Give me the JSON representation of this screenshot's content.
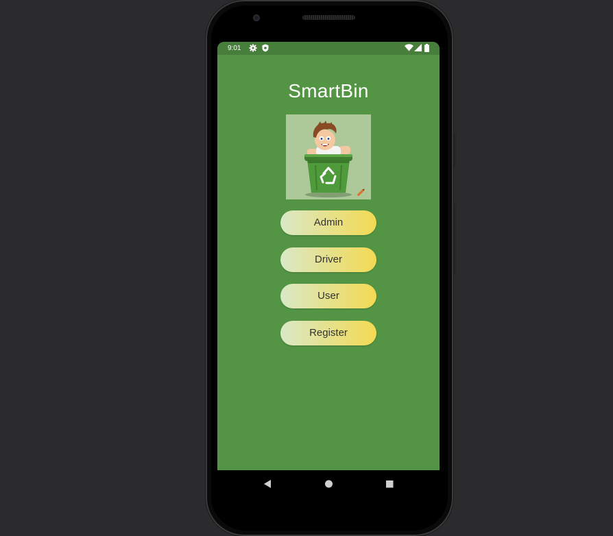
{
  "statusbar": {
    "time": "9:01",
    "icons": [
      "settings-gear-icon",
      "shield-icon",
      "wifi-icon",
      "signal-icon",
      "battery-icon"
    ]
  },
  "app": {
    "title": "SmartBin",
    "logo": "boy-in-recycling-bin-logo"
  },
  "buttons": {
    "admin": "Admin",
    "driver": "Driver",
    "user": "User",
    "register": "Register"
  },
  "navbar": {
    "icons": [
      "back-triangle-icon",
      "home-circle-icon",
      "recents-square-icon"
    ]
  },
  "colors": {
    "background": "#539545",
    "statusbar": "#487e3c",
    "button_gradient_start": "#d9e8c6",
    "button_gradient_end": "#f3da52"
  }
}
